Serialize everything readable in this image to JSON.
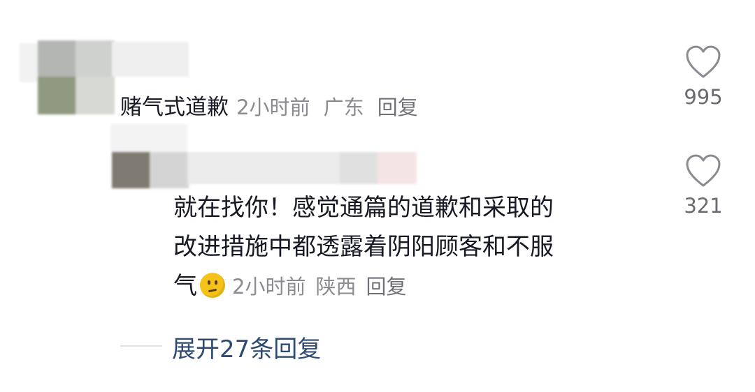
{
  "comment": {
    "author": "赌气式道歉",
    "time": "2小时前",
    "location": "广东",
    "reply_label": "回复",
    "like_count": "995"
  },
  "reply": {
    "text": "就在找你！感觉通篇的道歉和采取的改进措施中都透露着阴阳顾客和不服气",
    "line1": "就在找你！感觉通篇的道歉和采取的",
    "line2": "改进措施中都透露着阴阳顾客和不服",
    "line3": "气",
    "emoji": "confused-face",
    "time": "2小时前",
    "location": "陕西",
    "reply_label": "回复",
    "like_count": "321"
  },
  "expand": {
    "label": "展开27条回复"
  },
  "colors": {
    "text_primary": "#161823",
    "text_meta": "#8a8b91",
    "expand_link": "#2e4a72"
  }
}
